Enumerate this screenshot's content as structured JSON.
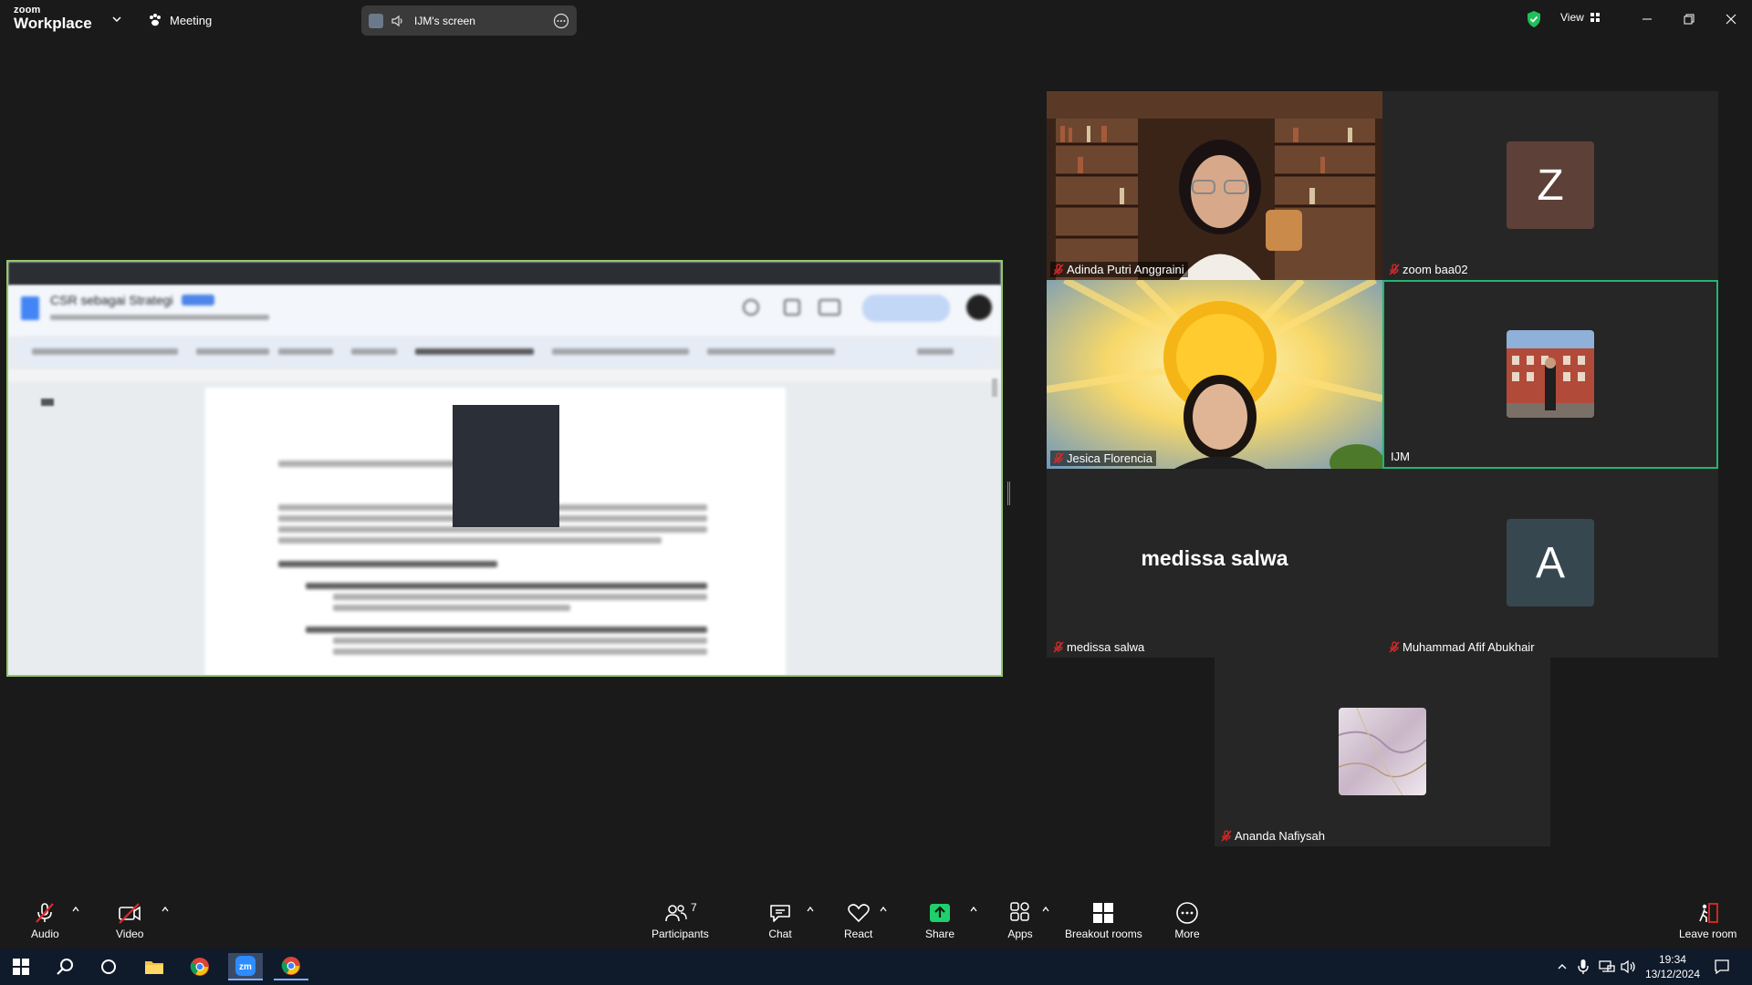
{
  "app": {
    "logo_small": "zoom",
    "logo_big": "Workplace"
  },
  "header": {
    "meeting_label": "Meeting",
    "screen_pill_label": "IJM's screen",
    "view_label": "View"
  },
  "shared_doc": {
    "doc_title": "CSR sebagai Strategi"
  },
  "participants": [
    {
      "name": "Adinda Putri Anggraini",
      "muted": true
    },
    {
      "name": "zoom baa02",
      "muted": true,
      "avatar_letter": "Z",
      "avatar_color": "#5d4037"
    },
    {
      "name": "Jesica Florencia",
      "muted": true
    },
    {
      "name": "IJM",
      "muted": false,
      "active_speaker": true
    },
    {
      "name": "medissa salwa",
      "muted": true,
      "display_name": "medissa salwa"
    },
    {
      "name": "Muhammad Afif Abukhair",
      "muted": true,
      "avatar_letter": "A",
      "avatar_color": "#37474f"
    },
    {
      "name": "Ananda Nafiysah",
      "muted": true
    }
  ],
  "toolbar": {
    "audio": "Audio",
    "video": "Video",
    "participants": "Participants",
    "participants_count": "7",
    "chat": "Chat",
    "react": "React",
    "share": "Share",
    "apps": "Apps",
    "breakout": "Breakout rooms",
    "more": "More",
    "leave": "Leave room"
  },
  "taskbar": {
    "time": "19:34",
    "date": "13/12/2024"
  },
  "colors": {
    "active_border": "#22b573",
    "share_border": "#93c76a",
    "muted_red": "#e02828",
    "share_green": "#1fcf6b"
  }
}
